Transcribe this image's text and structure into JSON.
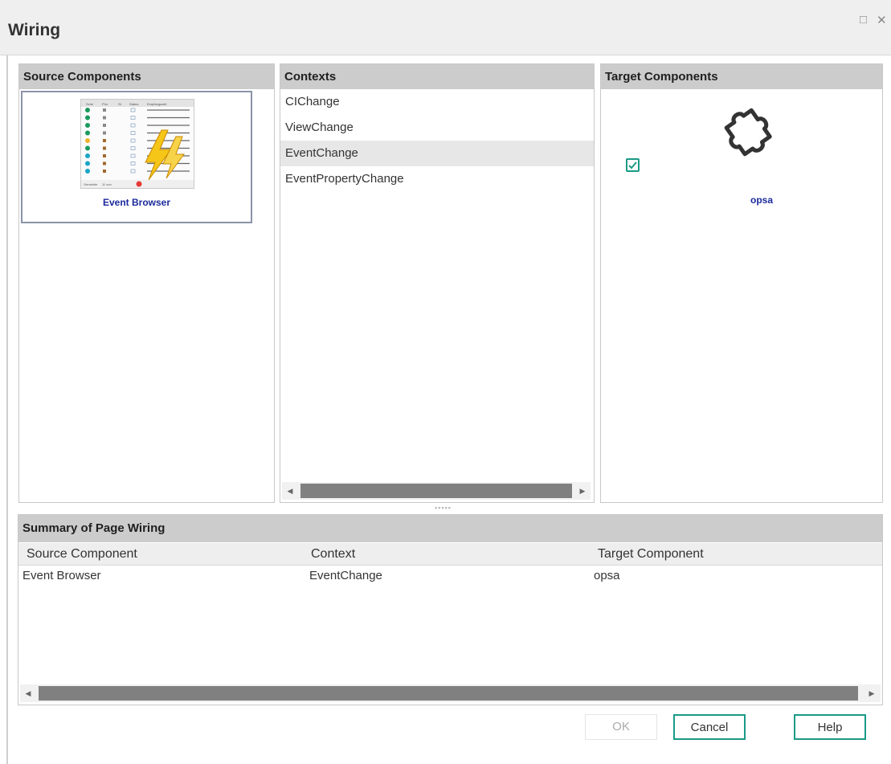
{
  "dialog": {
    "title": "Wiring",
    "maximize_glyph": "□",
    "close_glyph": "✕"
  },
  "source_panel": {
    "header": "Source Components",
    "card": {
      "label": "Event Browser",
      "thumbnail": {
        "columns": [
          "Sche",
          "Prio",
          "St",
          "Status",
          "Empfangszeit"
        ],
        "footer_left": "Gemeinle",
        "footer_mid": "11 von"
      }
    }
  },
  "contexts_panel": {
    "header": "Contexts",
    "items": [
      {
        "label": "CIChange"
      },
      {
        "label": "ViewChange"
      },
      {
        "label": "EventChange",
        "selected": true
      },
      {
        "label": "EventPropertyChange"
      }
    ],
    "scroll_left_glyph": "◀",
    "scroll_right_glyph": "▶"
  },
  "target_panel": {
    "header": "Target Components",
    "items": [
      {
        "label": "opsa",
        "icon": "puzzle-icon",
        "checked": true
      }
    ]
  },
  "splitter_glyph": "▪▪▪▪▪",
  "summary": {
    "header": "Summary of Page Wiring",
    "columns": {
      "source": "Source Component",
      "context": "Context",
      "target": "Target Component"
    },
    "rows": [
      {
        "source": "Event Browser",
        "context": "EventChange",
        "target": "opsa"
      }
    ],
    "scroll_left_glyph": "◀",
    "scroll_right_glyph": "▶"
  },
  "buttons": {
    "ok": "OK",
    "cancel": "Cancel",
    "help": "Help"
  },
  "colors": {
    "header_bg": "#cccccc",
    "accent": "#1a9a86",
    "link_blue": "#1b2a9b",
    "selected_row": "#e7e7e7",
    "scroll_thumb": "#808080"
  }
}
